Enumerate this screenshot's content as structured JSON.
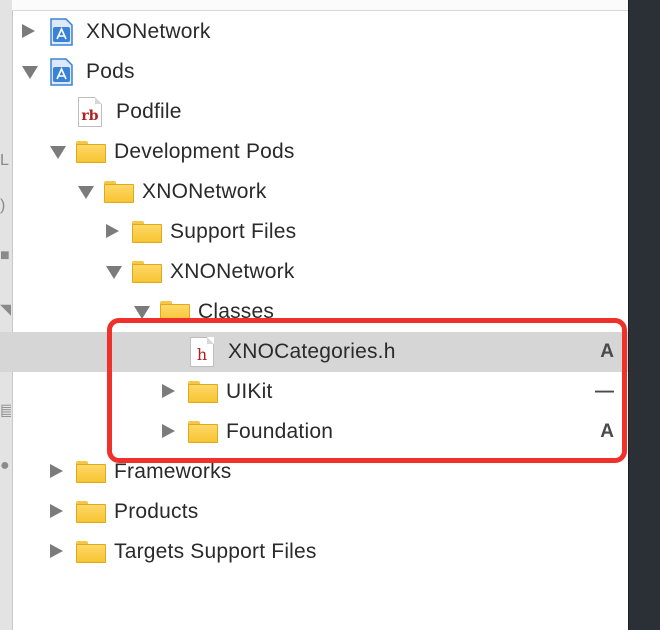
{
  "navigator": {
    "items": [
      {
        "label": "XNONetwork",
        "kind": "project",
        "disclosure": "collapsed",
        "depth": 0
      },
      {
        "label": "Pods",
        "kind": "project",
        "disclosure": "expanded",
        "depth": 0
      },
      {
        "label": "Podfile",
        "kind": "ruby-file",
        "file_badge": "rb",
        "disclosure": "none",
        "depth": 1
      },
      {
        "label": "Development Pods",
        "kind": "folder",
        "disclosure": "expanded",
        "depth": 1
      },
      {
        "label": "XNONetwork",
        "kind": "folder",
        "disclosure": "expanded",
        "depth": 2
      },
      {
        "label": "Support Files",
        "kind": "folder",
        "disclosure": "collapsed",
        "depth": 3
      },
      {
        "label": "XNONetwork",
        "kind": "folder",
        "disclosure": "expanded",
        "depth": 3
      },
      {
        "label": "Classes",
        "kind": "folder",
        "disclosure": "expanded",
        "depth": 4
      },
      {
        "label": "XNOCategories.h",
        "kind": "header-file",
        "file_badge": "h",
        "disclosure": "none",
        "depth": 5,
        "status": "A",
        "selected": true
      },
      {
        "label": "UIKit",
        "kind": "folder",
        "disclosure": "collapsed",
        "depth": 5,
        "status": "—"
      },
      {
        "label": "Foundation",
        "kind": "folder",
        "disclosure": "collapsed",
        "depth": 5,
        "status": "A"
      },
      {
        "label": "Frameworks",
        "kind": "folder",
        "disclosure": "collapsed",
        "depth": 1
      },
      {
        "label": "Products",
        "kind": "folder",
        "disclosure": "collapsed",
        "depth": 1
      },
      {
        "label": "Targets Support Files",
        "kind": "folder",
        "disclosure": "collapsed",
        "depth": 1
      }
    ]
  },
  "colors": {
    "selection": "#d6d6d6",
    "highlight_border": "#f0302a",
    "folder": "#f7c432",
    "editor_dark": "#2b2f36"
  }
}
